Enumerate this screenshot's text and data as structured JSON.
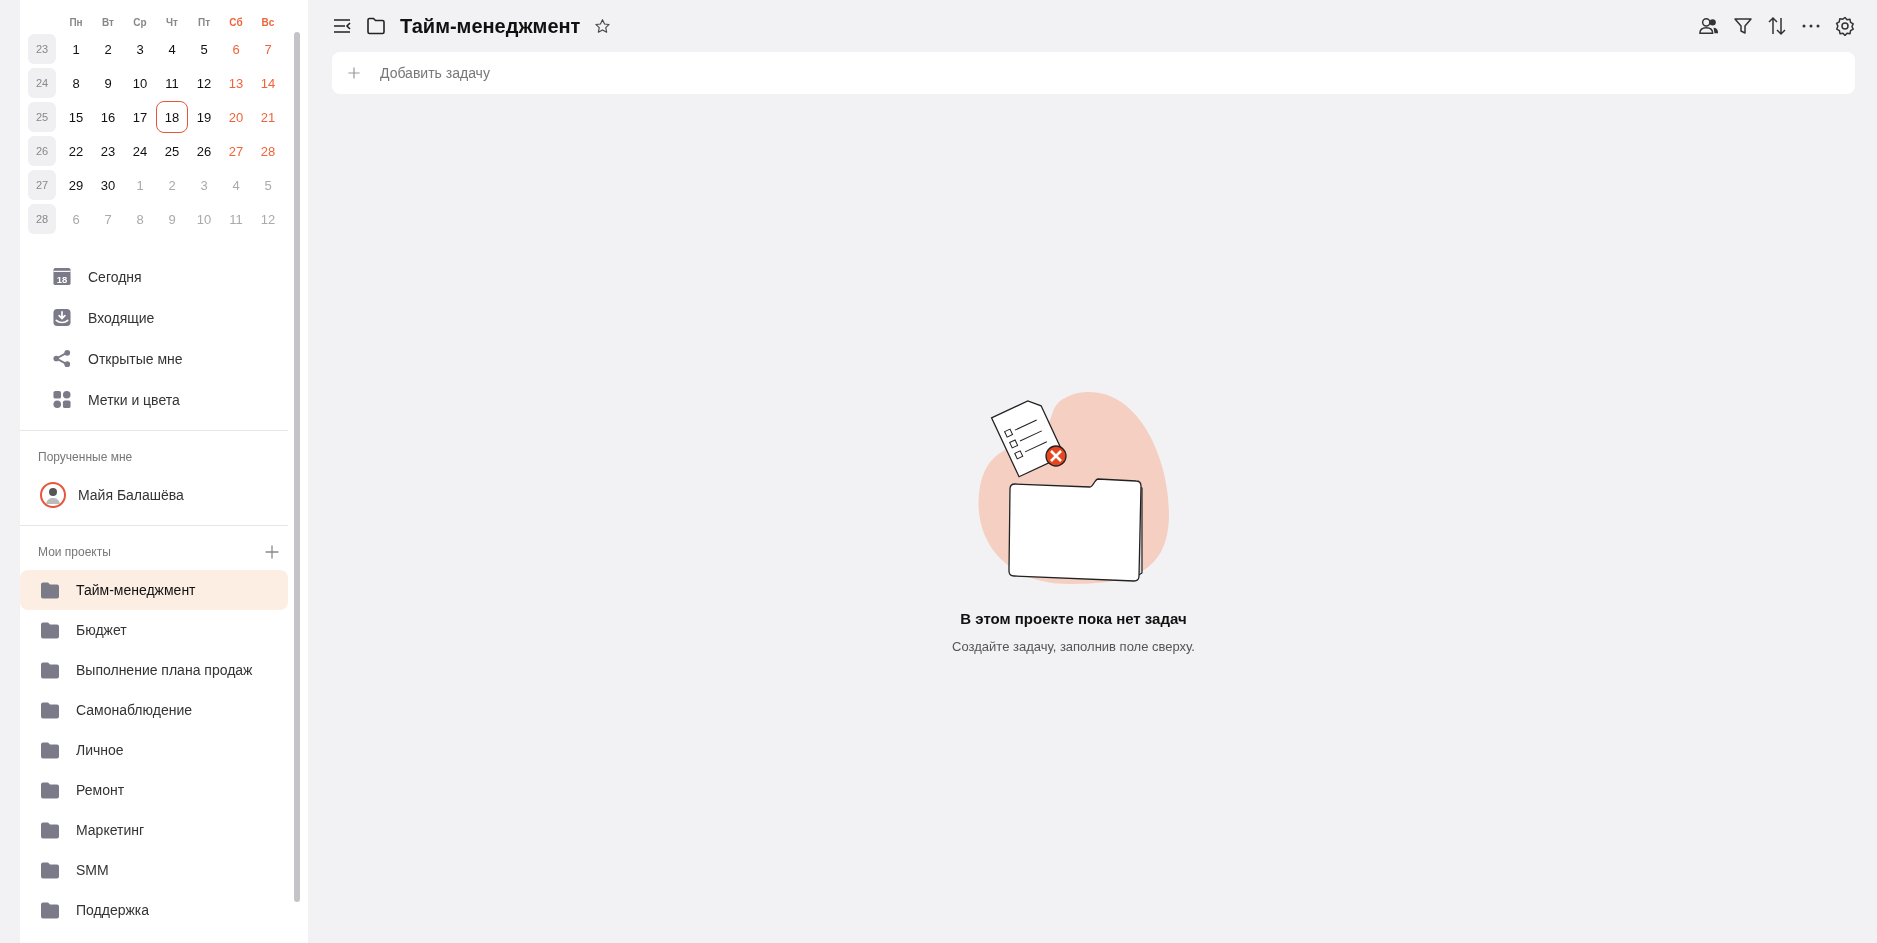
{
  "calendar": {
    "weekdays": [
      "Пн",
      "Вт",
      "Ср",
      "Чт",
      "Пт",
      "Сб",
      "Вс"
    ],
    "weeks": [
      {
        "number": "23",
        "days": [
          {
            "day": "1",
            "outside": false,
            "today": false
          },
          {
            "day": "2",
            "outside": false,
            "today": false
          },
          {
            "day": "3",
            "outside": false,
            "today": false
          },
          {
            "day": "4",
            "outside": false,
            "today": false
          },
          {
            "day": "5",
            "outside": false,
            "today": false
          },
          {
            "day": "6",
            "outside": false,
            "today": false
          },
          {
            "day": "7",
            "outside": false,
            "today": false
          }
        ]
      },
      {
        "number": "24",
        "days": [
          {
            "day": "8",
            "outside": false,
            "today": false
          },
          {
            "day": "9",
            "outside": false,
            "today": false
          },
          {
            "day": "10",
            "outside": false,
            "today": false
          },
          {
            "day": "11",
            "outside": false,
            "today": false
          },
          {
            "day": "12",
            "outside": false,
            "today": false
          },
          {
            "day": "13",
            "outside": false,
            "today": false
          },
          {
            "day": "14",
            "outside": false,
            "today": false
          }
        ]
      },
      {
        "number": "25",
        "days": [
          {
            "day": "15",
            "outside": false,
            "today": false
          },
          {
            "day": "16",
            "outside": false,
            "today": false
          },
          {
            "day": "17",
            "outside": false,
            "today": false
          },
          {
            "day": "18",
            "outside": false,
            "today": true
          },
          {
            "day": "19",
            "outside": false,
            "today": false
          },
          {
            "day": "20",
            "outside": false,
            "today": false
          },
          {
            "day": "21",
            "outside": false,
            "today": false
          }
        ]
      },
      {
        "number": "26",
        "days": [
          {
            "day": "22",
            "outside": false,
            "today": false
          },
          {
            "day": "23",
            "outside": false,
            "today": false
          },
          {
            "day": "24",
            "outside": false,
            "today": false
          },
          {
            "day": "25",
            "outside": false,
            "today": false
          },
          {
            "day": "26",
            "outside": false,
            "today": false
          },
          {
            "day": "27",
            "outside": false,
            "today": false
          },
          {
            "day": "28",
            "outside": false,
            "today": false
          }
        ]
      },
      {
        "number": "27",
        "days": [
          {
            "day": "29",
            "outside": false,
            "today": false
          },
          {
            "day": "30",
            "outside": false,
            "today": false
          },
          {
            "day": "1",
            "outside": true,
            "today": false
          },
          {
            "day": "2",
            "outside": true,
            "today": false
          },
          {
            "day": "3",
            "outside": true,
            "today": false
          },
          {
            "day": "4",
            "outside": true,
            "today": false
          },
          {
            "day": "5",
            "outside": true,
            "today": false
          }
        ]
      },
      {
        "number": "28",
        "days": [
          {
            "day": "6",
            "outside": true,
            "today": false
          },
          {
            "day": "7",
            "outside": true,
            "today": false
          },
          {
            "day": "8",
            "outside": true,
            "today": false
          },
          {
            "day": "9",
            "outside": true,
            "today": false
          },
          {
            "day": "10",
            "outside": true,
            "today": false
          },
          {
            "day": "11",
            "outside": true,
            "today": false
          },
          {
            "day": "12",
            "outside": true,
            "today": false
          }
        ]
      }
    ]
  },
  "nav": [
    {
      "kind": "today",
      "label": "Сегодня",
      "icon_text": "18"
    },
    {
      "kind": "inbox",
      "label": "Входящие"
    },
    {
      "kind": "shared",
      "label": "Открытые мне"
    },
    {
      "kind": "tags",
      "label": "Метки и цвета"
    }
  ],
  "assigned": {
    "title": "Порученные мне",
    "people": [
      {
        "name": "Майя Балашёва"
      }
    ]
  },
  "projects": {
    "title": "Мои проекты",
    "items": [
      {
        "label": "Тайм-менеджмент",
        "selected": true
      },
      {
        "label": "Бюджет",
        "selected": false
      },
      {
        "label": "Выполнение плана продаж",
        "selected": false
      },
      {
        "label": "Самонаблюдение",
        "selected": false
      },
      {
        "label": "Личное",
        "selected": false
      },
      {
        "label": "Ремонт",
        "selected": false
      },
      {
        "label": "Маркетинг",
        "selected": false
      },
      {
        "label": "SMM",
        "selected": false
      },
      {
        "label": "Поддержка",
        "selected": false
      }
    ]
  },
  "header": {
    "title": "Тайм-менеджмент",
    "starred": false
  },
  "add_task": {
    "placeholder": "Добавить задачу"
  },
  "empty_state": {
    "title": "В этом проекте пока нет задач",
    "subtitle": "Создайте задачу, заполнив поле сверху."
  }
}
